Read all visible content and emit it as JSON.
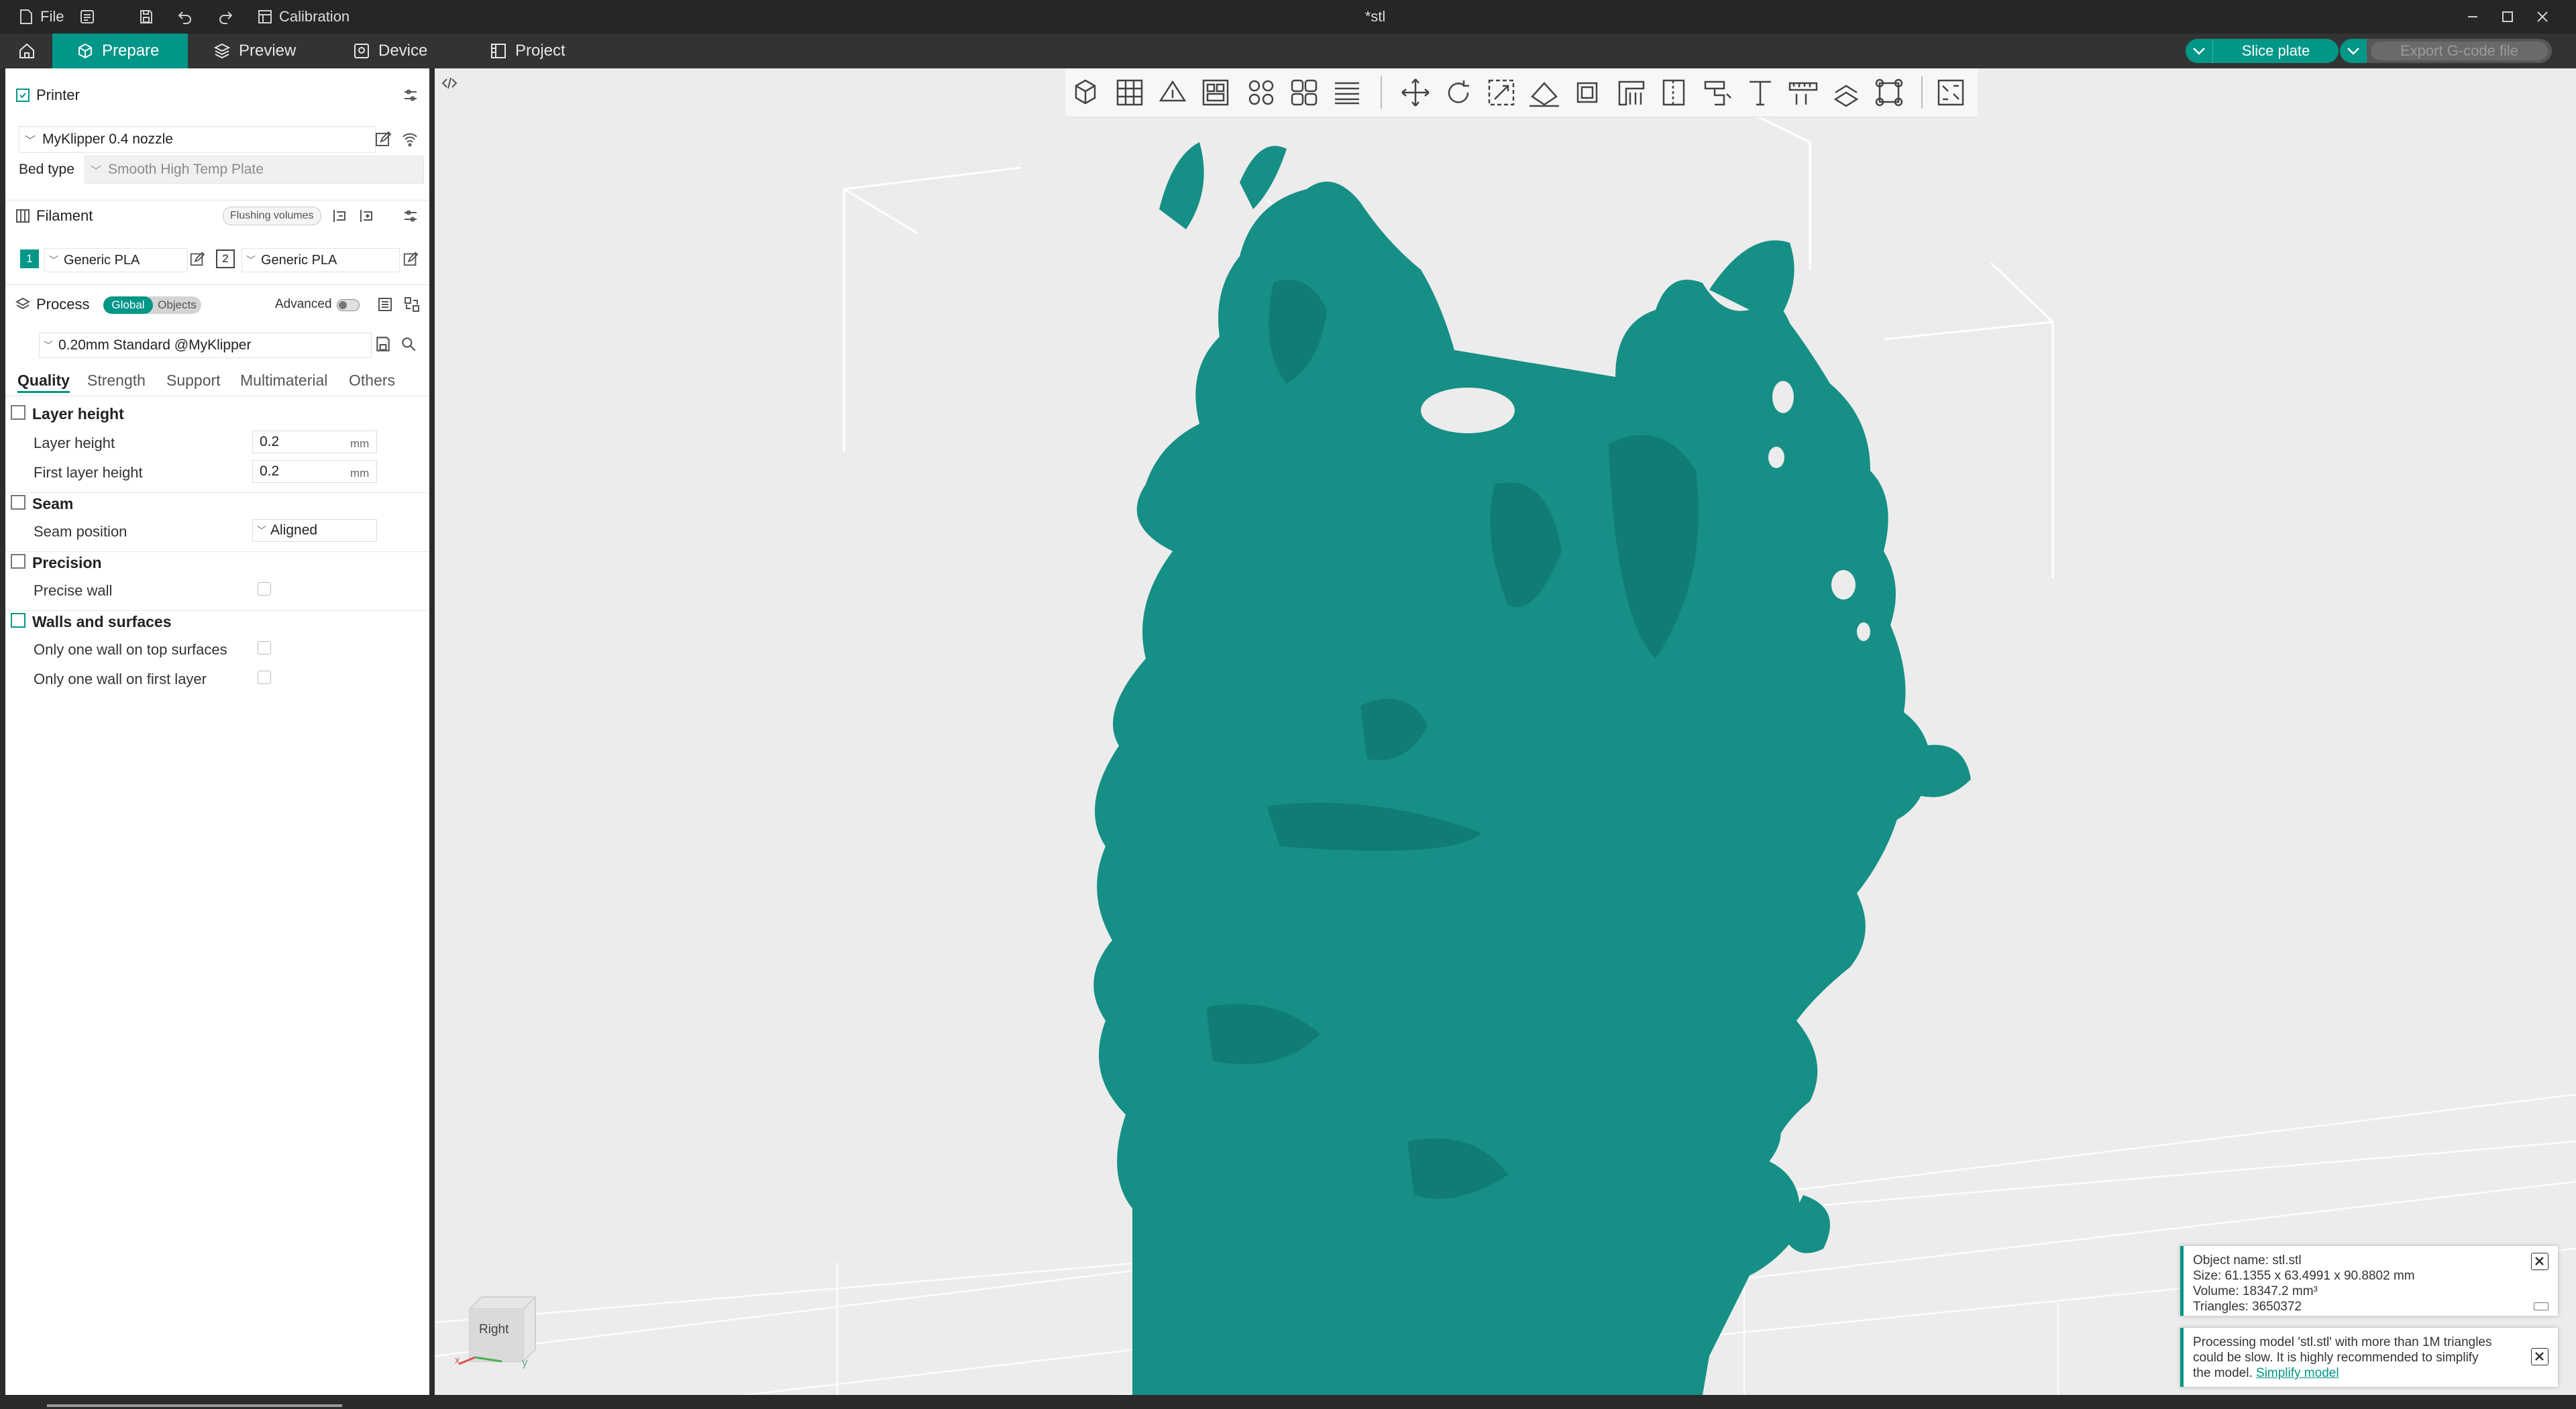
{
  "titlebar": {
    "file_label": "File",
    "calibration_label": "Calibration",
    "window_title": "*stl"
  },
  "menubar": {
    "tabs": [
      {
        "label": "Prepare"
      },
      {
        "label": "Preview"
      },
      {
        "label": "Device"
      },
      {
        "label": "Project"
      }
    ],
    "slice_label": "Slice plate",
    "export_label": "Export G-code file"
  },
  "printer": {
    "section_label": "Printer",
    "printer_name": "MyKlipper 0.4 nozzle",
    "bed_type_label": "Bed type",
    "bed_type_value": "Smooth High Temp Plate"
  },
  "filament": {
    "section_label": "Filament",
    "flushing_label": "Flushing volumes",
    "slots": [
      {
        "index": "1",
        "name": "Generic PLA",
        "color": "#009688"
      },
      {
        "index": "2",
        "name": "Generic PLA",
        "color": "#ffffff"
      }
    ]
  },
  "process": {
    "section_label": "Process",
    "global_label": "Global",
    "objects_label": "Objects",
    "advanced_label": "Advanced",
    "preset": "0.20mm Standard @MyKlipper",
    "tabs": [
      "Quality",
      "Strength",
      "Support",
      "Multimaterial",
      "Others"
    ],
    "groups": {
      "layer_height": {
        "title": "Layer height",
        "layer_height_label": "Layer height",
        "layer_height_value": "0.2",
        "first_layer_label": "First layer height",
        "first_layer_value": "0.2",
        "unit": "mm"
      },
      "seam": {
        "title": "Seam",
        "position_label": "Seam position",
        "position_value": "Aligned"
      },
      "precision": {
        "title": "Precision",
        "precise_wall_label": "Precise wall"
      },
      "walls": {
        "title": "Walls and surfaces",
        "one_wall_top_label": "Only one wall on top surfaces",
        "one_wall_first_label": "Only one wall on first layer"
      }
    }
  },
  "viewport": {
    "view_cube_label": "Right",
    "axis_y": "y",
    "axis_x": "x",
    "model_color": "#168f86",
    "toast_info": {
      "line1": "Object name: stl.stl",
      "line2": "Size: 61.1355 x 63.4991 x 90.8802 mm",
      "line3": "Volume: 18347.2 mm³",
      "line4": "Triangles: 3650372"
    },
    "toast_warning": {
      "line1": "Processing model 'stl.stl' with more than 1M triangles",
      "line2": "could be slow. It is highly recommended to simplify",
      "line3": "the model.",
      "link": "Simplify model"
    }
  },
  "colors": {
    "accent": "#009688",
    "titlebar": "#262626",
    "menubar": "#333333",
    "viewport": "#ececec"
  }
}
